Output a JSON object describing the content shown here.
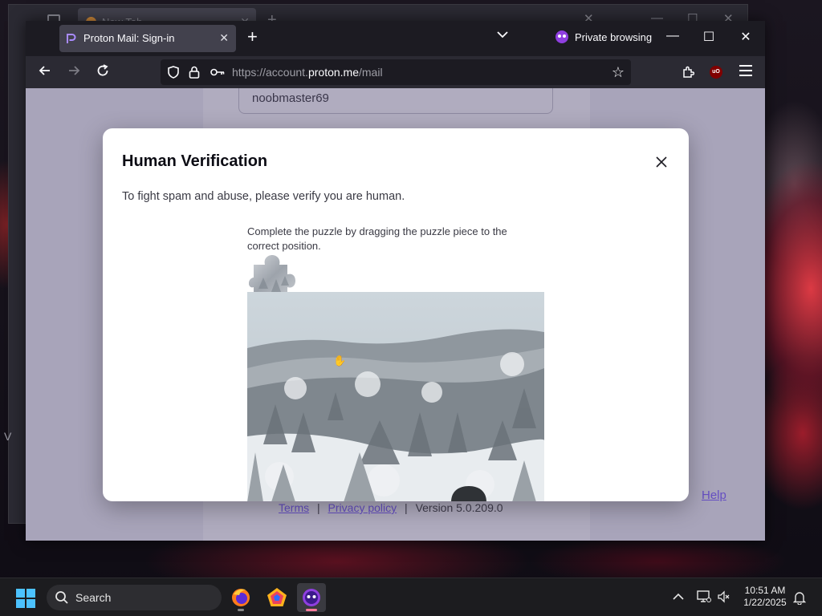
{
  "background_browser": {
    "tab_title": "New Tab",
    "left_text": "V"
  },
  "browser": {
    "tab_title": "Proton Mail: Sign-in",
    "private_label": "Private browsing",
    "url_prefix": "https://account.",
    "url_domain": "proton.me",
    "url_path": "/mail"
  },
  "page": {
    "username_value": "noobmaster69",
    "footer": {
      "terms": "Terms",
      "separator": "|",
      "privacy": "Privacy policy",
      "version": "Version 5.0.209.0"
    },
    "help": "Help"
  },
  "modal": {
    "title": "Human Verification",
    "description": "To fight spam and abuse, please verify you are human.",
    "puzzle_instruction": "Complete the puzzle by dragging the puzzle piece to the correct position."
  },
  "taskbar": {
    "search_label": "Search",
    "time": "10:51 AM",
    "date": "1/22/2025"
  },
  "colors": {
    "proton_purple": "#6d4aff",
    "firefox_private": "#8f3fe0",
    "windows_accent": "#4cc2ff"
  },
  "icons": [
    "tab-list-icon",
    "shield-icon",
    "lock-icon",
    "key-icon",
    "star-icon",
    "extensions-icon",
    "ublock-icon",
    "menu-icon",
    "close-icon",
    "bell-icon",
    "network-icon",
    "volume-muted-icon",
    "chevron-up-icon"
  ]
}
